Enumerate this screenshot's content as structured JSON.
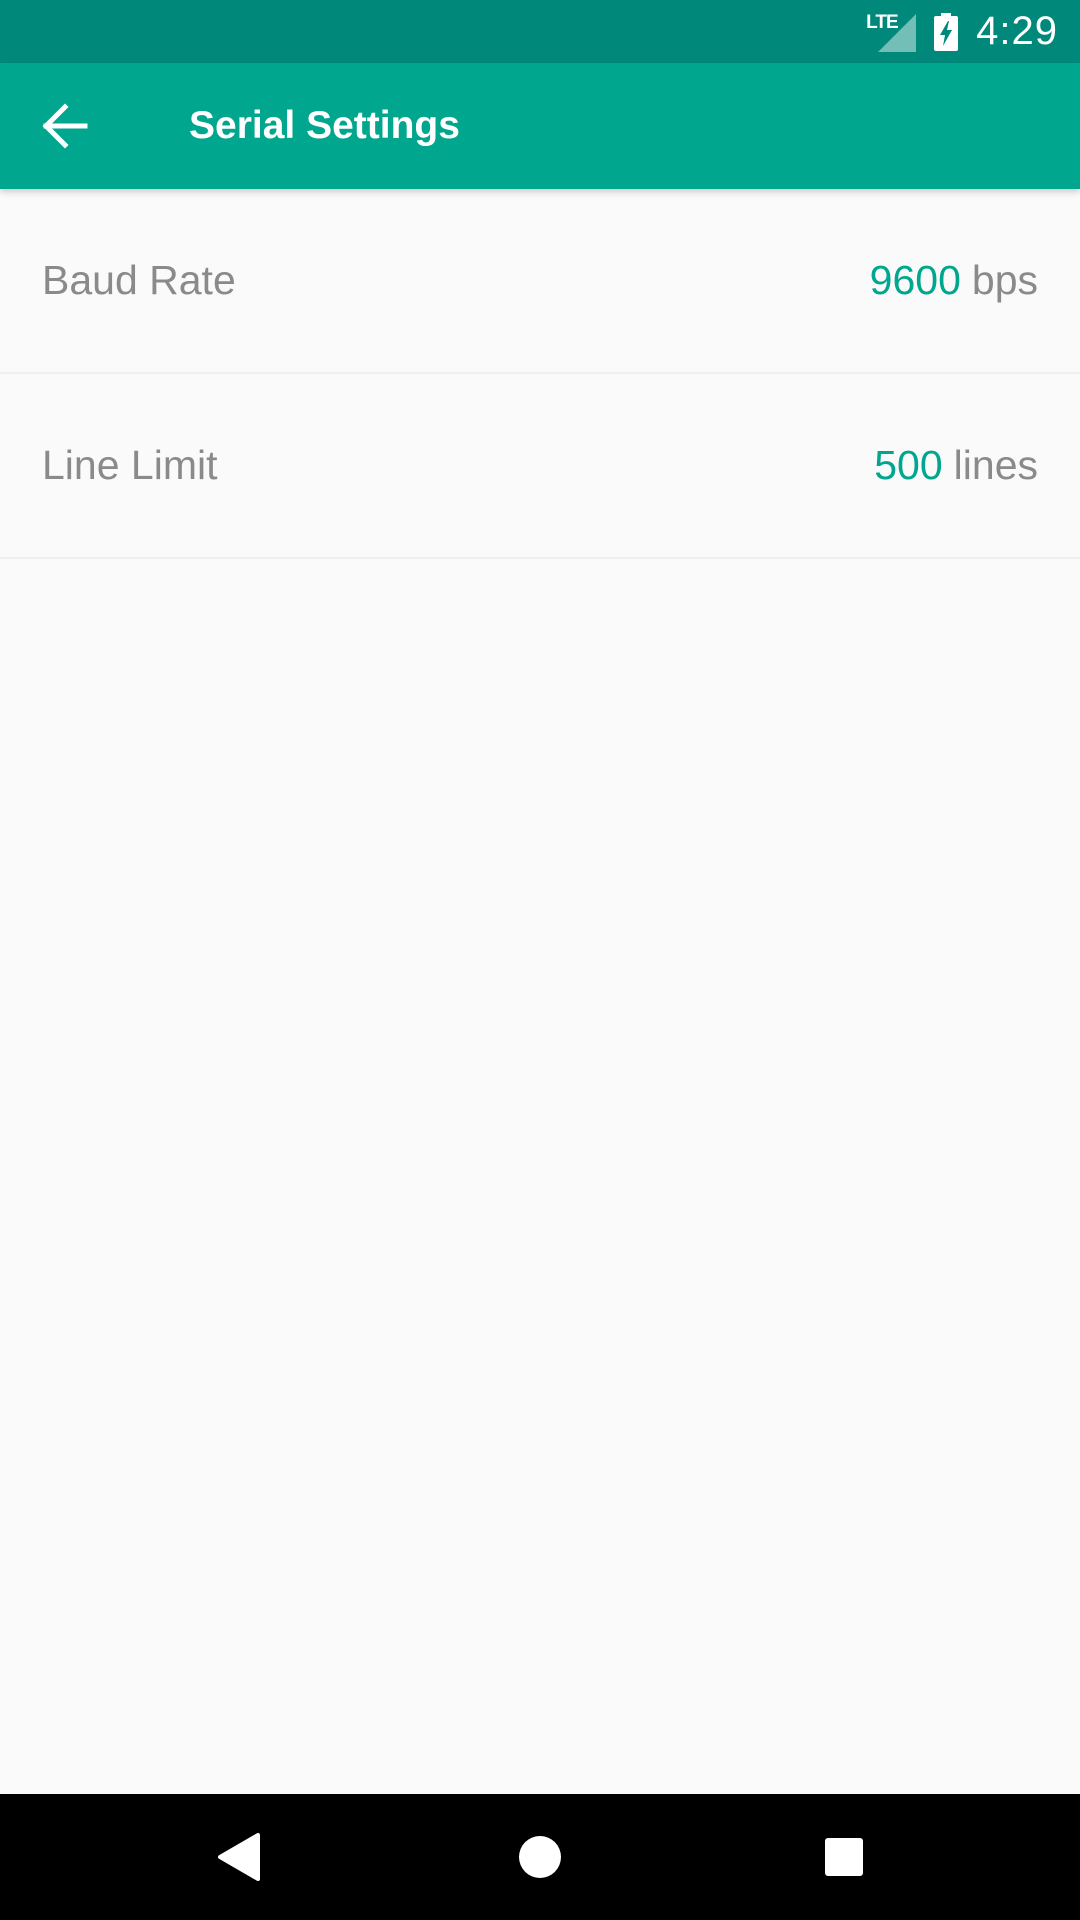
{
  "status_bar": {
    "network_label": "LTE",
    "time": "4:29"
  },
  "app_bar": {
    "title": "Serial Settings",
    "back_icon": "arrow-back-icon"
  },
  "settings": [
    {
      "label": "Baud Rate",
      "value": "9600",
      "unit": "bps"
    },
    {
      "label": "Line Limit",
      "value": "500",
      "unit": "lines"
    }
  ],
  "nav_bar": {
    "back_icon": "nav-back-triangle-icon",
    "home_icon": "nav-home-circle-icon",
    "recents_icon": "nav-recents-square-icon"
  },
  "colors": {
    "status_bar": "#00897b",
    "app_bar": "#00a68d",
    "accent_value": "#00a68d",
    "label_text": "#8a8a8a",
    "background": "#fafafa"
  }
}
